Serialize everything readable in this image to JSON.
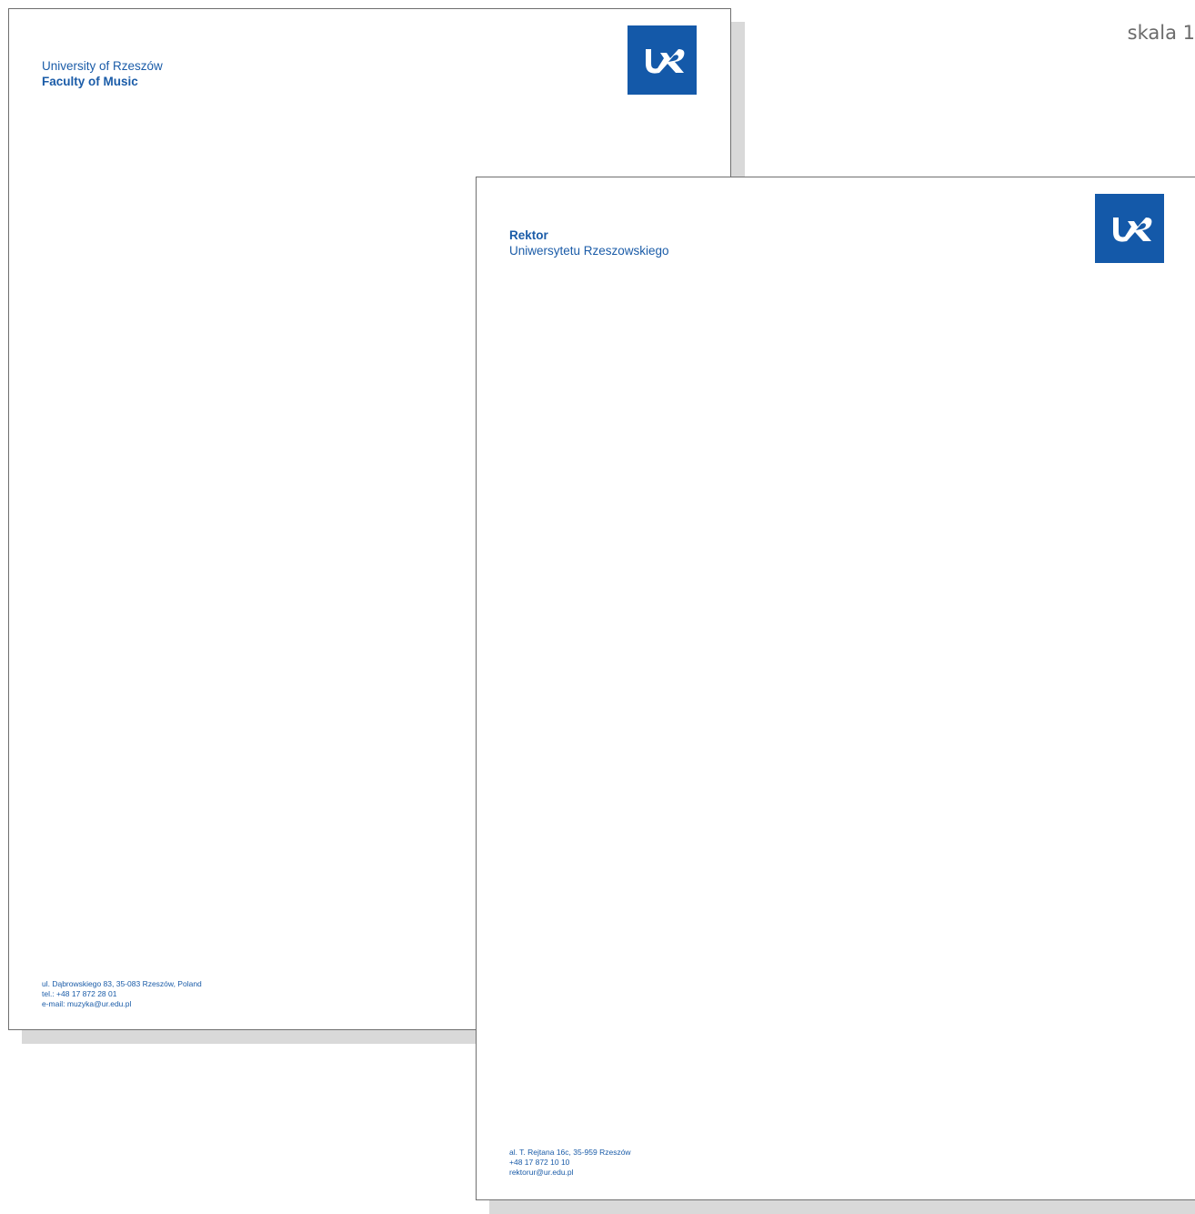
{
  "scale_label": "skala 1",
  "letterhead_english": {
    "line1": "University of Rzeszów",
    "line2": "Faculty of Music",
    "footer": {
      "address": "ul. Dąbrowskiego 83, 35-083 Rzeszów, Poland",
      "phone": "tel.: +48 17 872 28 01",
      "email": "e-mail: muzyka@ur.edu.pl"
    }
  },
  "letterhead_polish": {
    "line1": "Rektor",
    "line2": "Uniwersytetu Rzeszowskiego",
    "footer": {
      "address": "al. T. Rejtana 16c, 35-959 Rzeszów",
      "phone": "+48 17 872 10 10",
      "email": "rektorur@ur.edu.pl"
    }
  },
  "colors": {
    "brand_blue": "#1459a9",
    "text_blue": "#1b5ca8",
    "shadow": "#d9d9d9"
  },
  "logo": {
    "icon": "ur-logo-icon"
  }
}
